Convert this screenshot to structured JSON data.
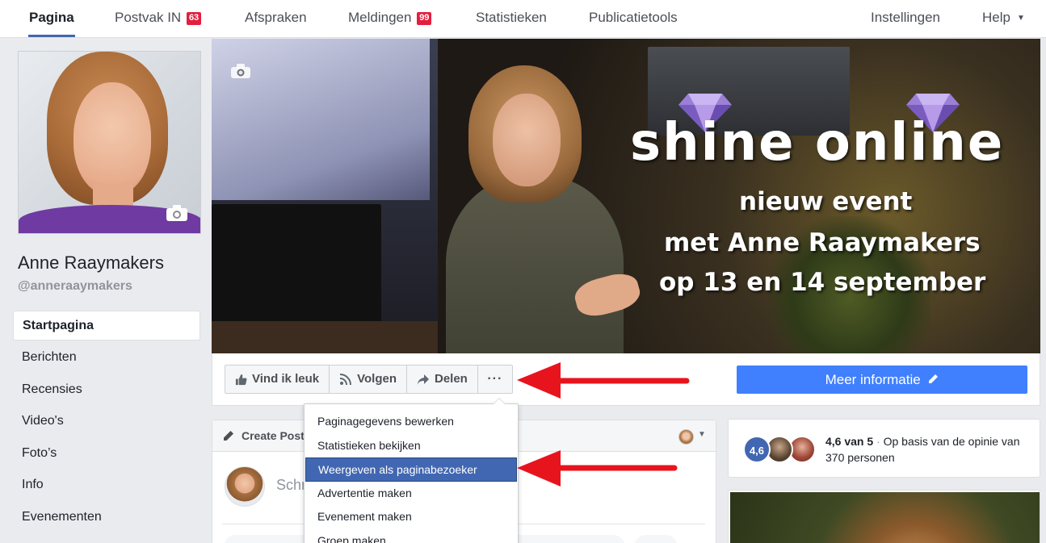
{
  "topnav": {
    "items": [
      {
        "label": "Pagina",
        "active": true
      },
      {
        "label": "Postvak IN",
        "badge": "63"
      },
      {
        "label": "Afspraken"
      },
      {
        "label": "Meldingen",
        "badge": "99"
      },
      {
        "label": "Statistieken"
      },
      {
        "label": "Publicatietools"
      }
    ],
    "settings": "Instellingen",
    "help": "Help"
  },
  "profile": {
    "name": "Anne Raaymakers",
    "handle": "@anneraaymakers"
  },
  "sidebar": {
    "items": [
      {
        "label": "Startpagina",
        "active": true
      },
      {
        "label": "Berichten"
      },
      {
        "label": "Recensies"
      },
      {
        "label": "Video's"
      },
      {
        "label": "Foto’s"
      },
      {
        "label": "Info"
      },
      {
        "label": "Evenementen"
      }
    ]
  },
  "cover": {
    "title": "shine online",
    "line1": "nieuw event",
    "line2": "met Anne Raaymakers",
    "line3": "op 13 en 14 september"
  },
  "actions": {
    "like": "Vind ik leuk",
    "follow": "Volgen",
    "share": "Delen",
    "more": "···",
    "meer_info": "Meer informatie"
  },
  "dropdown": {
    "items": [
      {
        "label": "Paginagegevens bewerken"
      },
      {
        "label": "Statistieken bekijken"
      },
      {
        "label": "Weergeven als paginabezoeker",
        "highlighted": true
      },
      {
        "label": "Advertentie maken"
      },
      {
        "label": "Evenement maken"
      },
      {
        "label": "Groep maken"
      }
    ]
  },
  "create_post": {
    "title": "Create Post",
    "placeholder": "Schrijf iets..."
  },
  "rating": {
    "badge": "4,6",
    "score": "4,6 van 5",
    "separator": " · ",
    "basis": "Op basis van de opinie van 370 personen"
  },
  "colors": {
    "accent": "#4267b2",
    "cta": "#4080ff",
    "badge": "#e41e3f",
    "annotation_arrow": "#e8141d"
  }
}
